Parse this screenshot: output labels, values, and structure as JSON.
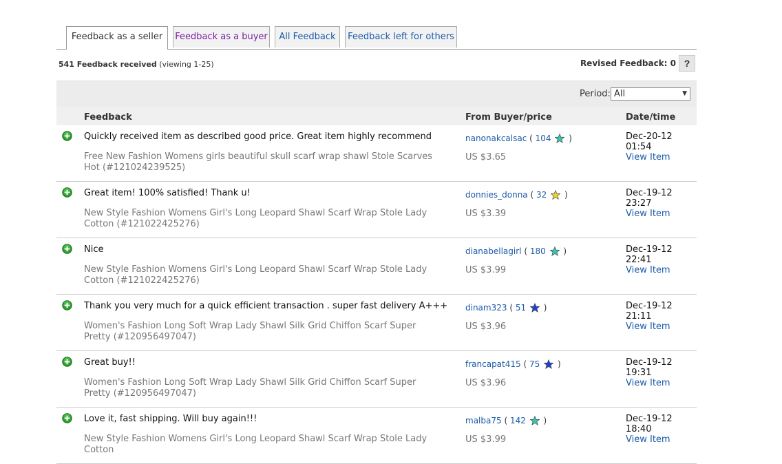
{
  "tabs": [
    {
      "label": "Feedback as a seller"
    },
    {
      "label": "Feedback as a buyer"
    },
    {
      "label": "All Feedback"
    },
    {
      "label": "Feedback left for others"
    }
  ],
  "summary": {
    "count_label": "541 Feedback received",
    "viewing": "(viewing 1-25)",
    "revised_label": "Revised Feedback: 0",
    "help_label": "?"
  },
  "period": {
    "label": "Period:",
    "value": "All"
  },
  "columns": {
    "feedback": "Feedback",
    "buyer": "From Buyer/price",
    "date": "Date/time"
  },
  "colors": {
    "plus": "#2e9e2e",
    "star_teal": "#35c9b5",
    "star_yellow": "#f3d12a",
    "star_blue": "#1f3fd6",
    "link": "#1a5aa8"
  },
  "rows": [
    {
      "comment": "Quickly received item as described good price. Great item highly recommend",
      "buyer": "nanonakcalsac",
      "score": "104",
      "star": "star_teal",
      "date": "Dec-20-12 01:54",
      "item": "Free New Fashion Womens girls beautiful skull scarf wrap shawl Stole Scarves Hot (#121024239525)",
      "price": "US $3.65",
      "view": "View Item"
    },
    {
      "comment": "Great item! 100% satisfied! Thank u!",
      "buyer": "donnies_donna",
      "score": "32",
      "star": "star_yellow",
      "date": "Dec-19-12 23:27",
      "item": "New Style Fashion Womens Girl's Long Leopard Shawl Scarf Wrap Stole Lady Cotton (#121022425276)",
      "price": "US $3.39",
      "view": "View Item"
    },
    {
      "comment": "Nice",
      "buyer": "dianabellagirl",
      "score": "180",
      "star": "star_teal",
      "date": "Dec-19-12 22:41",
      "item": "New Style Fashion Womens Girl's Long Leopard Shawl Scarf Wrap Stole Lady Cotton (#121022425276)",
      "price": "US $3.99",
      "view": "View Item"
    },
    {
      "comment": "Thank you very much for a quick efficient transaction . super fast delivery A+++",
      "buyer": "dinam323",
      "score": "51",
      "star": "star_blue",
      "date": "Dec-19-12 21:11",
      "item": "Women's Fashion Long Soft Wrap Lady Shawl Silk Grid Chiffon Scarf Super Pretty (#120956497047)",
      "price": "US $3.96",
      "view": "View Item"
    },
    {
      "comment": "Great buy!!",
      "buyer": "francapat415",
      "score": "75",
      "star": "star_blue",
      "date": "Dec-19-12 19:31",
      "item": "Women's Fashion Long Soft Wrap Lady Shawl Silk Grid Chiffon Scarf Super Pretty (#120956497047)",
      "price": "US $3.96",
      "view": "View Item"
    },
    {
      "comment": "Love it, fast shipping. Will buy again!!!",
      "buyer": "malba75",
      "score": "142",
      "star": "star_teal",
      "date": "Dec-19-12 18:40",
      "item": "New Style Fashion Womens Girl's Long Leopard Shawl Scarf Wrap Stole Lady Cotton",
      "price": "US $3.99",
      "view": "View Item"
    }
  ]
}
